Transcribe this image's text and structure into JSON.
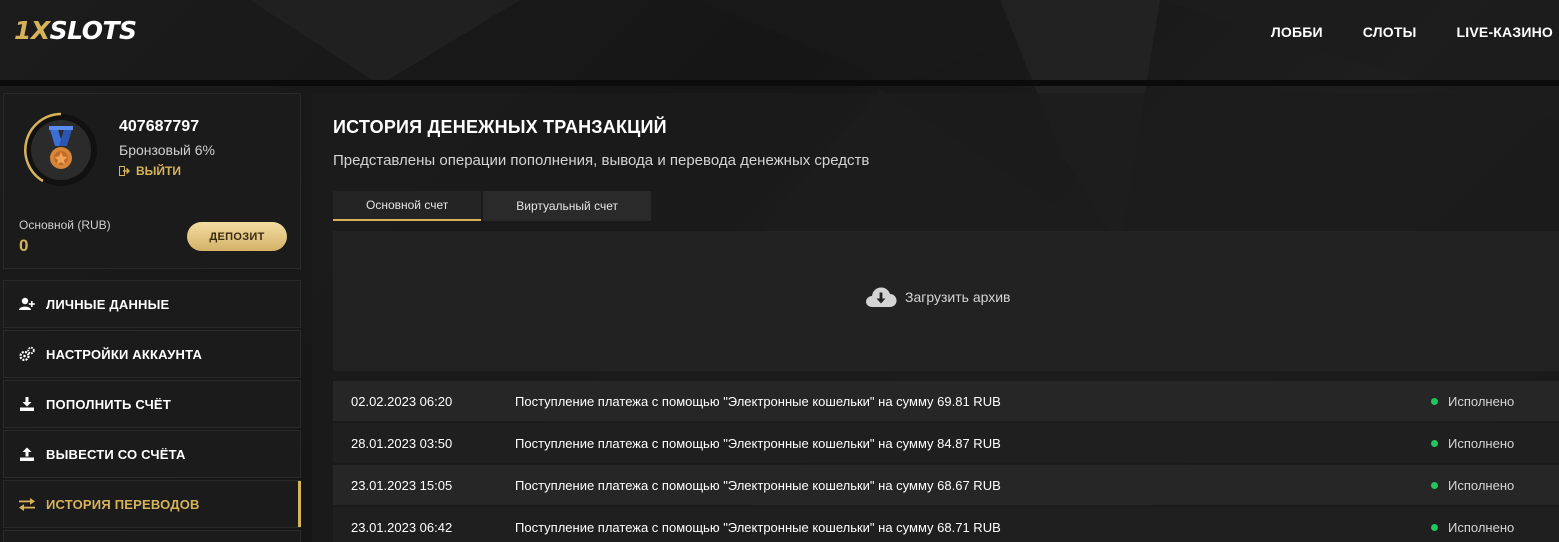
{
  "header": {
    "logo_part1": "1X",
    "logo_part2": "SLOTS",
    "nav": [
      "ЛОББИ",
      "СЛОТЫ",
      "LIVE-КАЗИНО"
    ]
  },
  "profile": {
    "user_id": "407687797",
    "level": "Бронзовый 6%",
    "logout_label": "ВЫЙТИ",
    "balance_label": "Основной (RUB)",
    "balance_value": "0",
    "deposit_label": "ДЕПОЗИТ"
  },
  "menu": [
    {
      "label": "ЛИЧНЫЕ ДАННЫЕ",
      "icon": "user-plus-icon"
    },
    {
      "label": "НАСТРОЙКИ АККАУНТА",
      "icon": "gears-icon"
    },
    {
      "label": "ПОПОЛНИТЬ СЧЁТ",
      "icon": "download-icon"
    },
    {
      "label": "ВЫВЕСТИ СО СЧЁТА",
      "icon": "upload-icon"
    },
    {
      "label": "ИСТОРИЯ ПЕРЕВОДОВ",
      "icon": "transfer-arrows-icon",
      "active": true
    }
  ],
  "main": {
    "title": "ИСТОРИЯ ДЕНЕЖНЫХ ТРАНЗАКЦИЙ",
    "subtitle": "Представлены операции пополнения, вывода и перевода денежных средств",
    "tabs": [
      "Основной счет",
      "Виртуальный счет"
    ],
    "archive_label": "Загрузить архив",
    "transactions": [
      {
        "date": "02.02.2023 06:20",
        "description": "Поступление платежа с помощью \"Электронные кошельки\" на сумму 69.81 RUB",
        "status": "Исполнено"
      },
      {
        "date": "28.01.2023 03:50",
        "description": "Поступление платежа с помощью \"Электронные кошельки\" на сумму 84.87 RUB",
        "status": "Исполнено"
      },
      {
        "date": "23.01.2023 15:05",
        "description": "Поступление платежа с помощью \"Электронные кошельки\" на сумму 68.67 RUB",
        "status": "Исполнено"
      },
      {
        "date": "23.01.2023 06:42",
        "description": "Поступление платежа с помощью \"Электронные кошельки\" на сумму 68.71 RUB",
        "status": "Исполнено"
      }
    ]
  },
  "colors": {
    "accent": "#d6b25a",
    "status_ok": "#22c55e"
  }
}
